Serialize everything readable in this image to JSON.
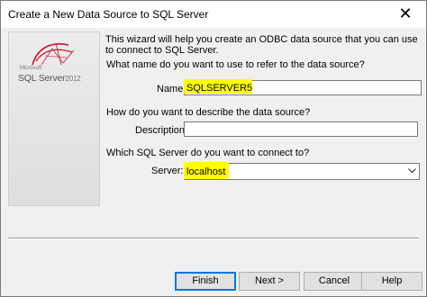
{
  "window": {
    "title": "Create a New Data Source to SQL Server",
    "close_glyph": "✕"
  },
  "logo": {
    "company": "Microsoft",
    "product": "SQL Server",
    "version": "2012"
  },
  "intro": "This wizard will help you create an ODBC data source that you can use to connect to SQL Server.",
  "name_section": {
    "question": "What name do you want to use to refer to the data source?",
    "label": "Name:",
    "value": "SQLSERVER5"
  },
  "description_section": {
    "question": "How do you want to describe the data source?",
    "label": "Description:",
    "value": ""
  },
  "server_section": {
    "question": "Which SQL Server do you want to connect to?",
    "label": "Server:",
    "value": "localhost"
  },
  "buttons": {
    "finish": "Finish",
    "next": "Next >",
    "cancel": "Cancel",
    "help": "Help"
  },
  "colors": {
    "highlight": "#ffff00",
    "logo_accent": "#c8102e",
    "default_button_border": "#0078d7"
  }
}
